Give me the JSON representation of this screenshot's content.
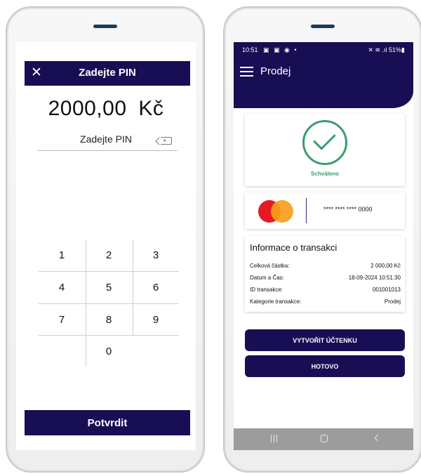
{
  "pin_screen": {
    "title": "Zadejte PIN",
    "amount": "2000,00 Kč",
    "pin_label": "Zadejte PIN",
    "clear_glyph": "×",
    "keypad": [
      "1",
      "2",
      "3",
      "4",
      "5",
      "6",
      "7",
      "8",
      "9",
      "0"
    ],
    "confirm_label": "Potvrdit"
  },
  "result_screen": {
    "status_bar": {
      "time": "10:51",
      "icons": "▣ ▣ ◉ •",
      "right": "✕ ≋ .ıl 51%▮"
    },
    "title": "Prodej",
    "status_text": "Schváleno",
    "card_number": "**** **** **** 0000",
    "info_title": "Informace o transakci",
    "info_rows": [
      {
        "label": "Celková částka:",
        "value": "2 000,00 Kč"
      },
      {
        "label": "Datum a Čas:",
        "value": "18-09-2024 10:51:30"
      },
      {
        "label": "ID transakce:",
        "value": "001001013"
      },
      {
        "label": "Kategorie transakce:",
        "value": "Prodej"
      }
    ],
    "receipt_button": "VYTVOŘIT ÚČTENKU",
    "done_button": "HOTOVO"
  },
  "colors": {
    "primary": "#180e54",
    "success": "#3a9d6e",
    "mastercard_red": "#e41a22",
    "mastercard_orange": "#f79e1b",
    "navbar": "#9c9c9c"
  }
}
